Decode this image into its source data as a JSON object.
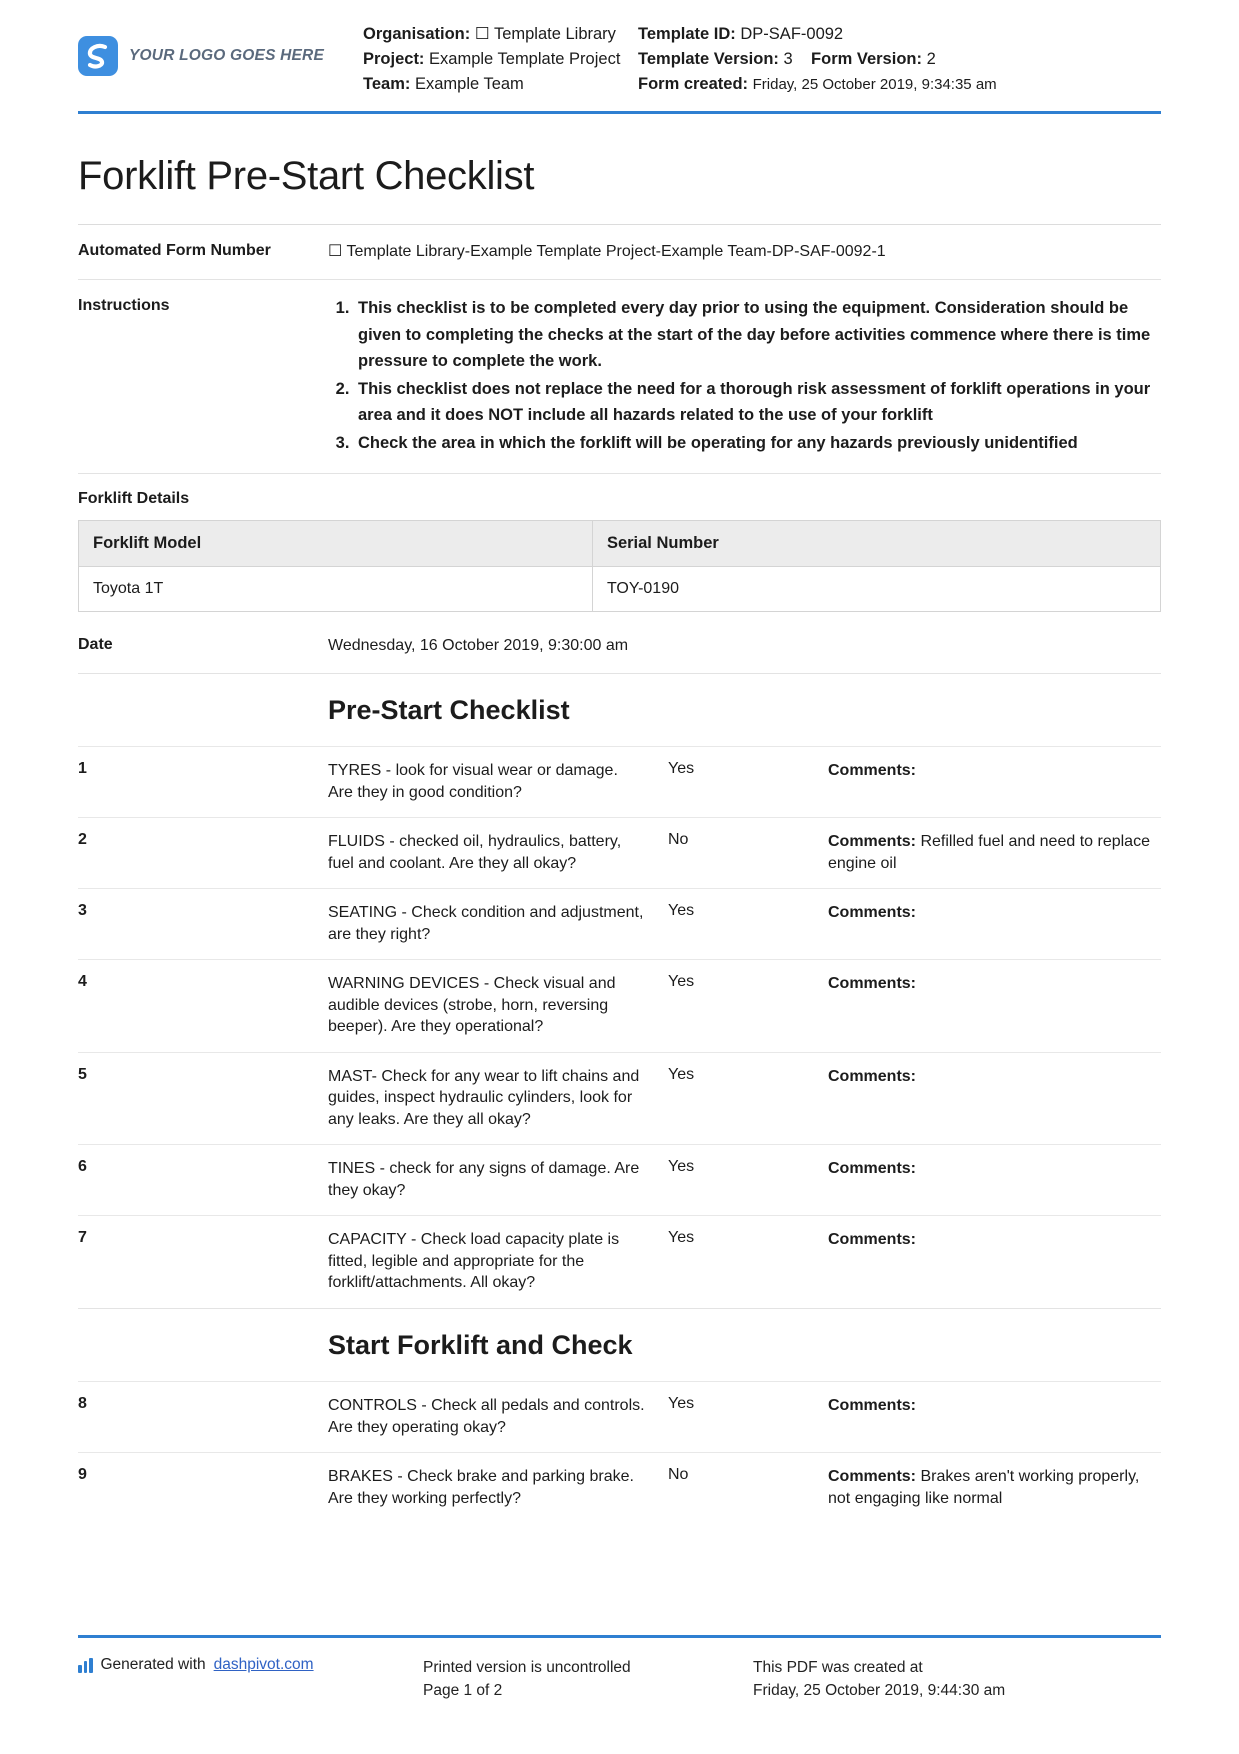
{
  "header": {
    "logo_text": "YOUR LOGO GOES HERE",
    "organisation_label": "Organisation:",
    "organisation_value": "☐ Template Library",
    "project_label": "Project:",
    "project_value": "Example Template Project",
    "team_label": "Team:",
    "team_value": "Example Team",
    "template_id_label": "Template ID:",
    "template_id_value": "DP-SAF-0092",
    "template_version_label": "Template Version:",
    "template_version_value": "3",
    "form_version_label": "Form Version:",
    "form_version_value": "2",
    "form_created_label": "Form created:",
    "form_created_value": "Friday, 25 October 2019, 9:34:35 am"
  },
  "title": "Forklift Pre-Start Checklist",
  "fields": {
    "auto_form_number_label": "Automated Form Number",
    "auto_form_number_value": "☐ Template Library-Example Template Project-Example Team-DP-SAF-0092-1",
    "instructions_label": "Instructions",
    "instructions": [
      "This checklist is to be completed every day prior to using the equipment. Consideration should be given to completing the checks at the start of the day before activities commence where there is time pressure to complete the work.",
      "This checklist does not replace the need for a thorough risk assessment of forklift operations in your area and it does NOT include all hazards related to the use of your forklift",
      "Check the area in which the forklift will be operating for any hazards previously unidentified"
    ],
    "date_label": "Date",
    "date_value": "Wednesday, 16 October 2019, 9:30:00 am"
  },
  "forklift_details": {
    "section_label": "Forklift Details",
    "columns": [
      "Forklift Model",
      "Serial Number"
    ],
    "row": [
      "Toyota 1T",
      "TOY-0190"
    ]
  },
  "sections": [
    {
      "heading": "Pre-Start Checklist",
      "rows": [
        {
          "num": "1",
          "text": "TYRES - look for visual wear or damage. Are they in good condition?",
          "answer": "Yes",
          "comments_label": "Comments:",
          "comments_value": ""
        },
        {
          "num": "2",
          "text": "FLUIDS - checked oil, hydraulics, battery, fuel and coolant. Are they all okay?",
          "answer": "No",
          "comments_label": "Comments:",
          "comments_value": "Refilled fuel and need to replace engine oil"
        },
        {
          "num": "3",
          "text": "SEATING - Check condition and adjustment, are they right?",
          "answer": "Yes",
          "comments_label": "Comments:",
          "comments_value": ""
        },
        {
          "num": "4",
          "text": "WARNING DEVICES - Check visual and audible devices (strobe, horn, reversing beeper). Are they operational?",
          "answer": "Yes",
          "comments_label": "Comments:",
          "comments_value": ""
        },
        {
          "num": "5",
          "text": "MAST- Check for any wear to lift chains and guides, inspect hydraulic cylinders, look for any leaks. Are they all okay?",
          "answer": "Yes",
          "comments_label": "Comments:",
          "comments_value": ""
        },
        {
          "num": "6",
          "text": "TINES - check for any signs of damage. Are they okay?",
          "answer": "Yes",
          "comments_label": "Comments:",
          "comments_value": ""
        },
        {
          "num": "7",
          "text": "CAPACITY - Check load capacity plate is fitted, legible and appropriate for the forklift/attachments. All okay?",
          "answer": "Yes",
          "comments_label": "Comments:",
          "comments_value": ""
        }
      ]
    },
    {
      "heading": "Start Forklift and Check",
      "rows": [
        {
          "num": "8",
          "text": "CONTROLS - Check all pedals and controls. Are they operating okay?",
          "answer": "Yes",
          "comments_label": "Comments:",
          "comments_value": ""
        },
        {
          "num": "9",
          "text": "BRAKES - Check brake and parking brake. Are they working perfectly?",
          "answer": "No",
          "comments_label": "Comments:",
          "comments_value": "Brakes aren't working properly, not engaging like normal"
        }
      ]
    }
  ],
  "footer": {
    "generated_prefix": "Generated with ",
    "generated_link": "dashpivot.com",
    "printed_line1": "Printed version is uncontrolled",
    "printed_line2": "Page 1 of 2",
    "created_line1": "This PDF was created at",
    "created_line2": "Friday, 25 October 2019, 9:44:30 am"
  },
  "colors": {
    "accent": "#2f7fd1",
    "logo": "#3e8fe0",
    "link": "#2f62c4",
    "table_header": "#ececec"
  }
}
